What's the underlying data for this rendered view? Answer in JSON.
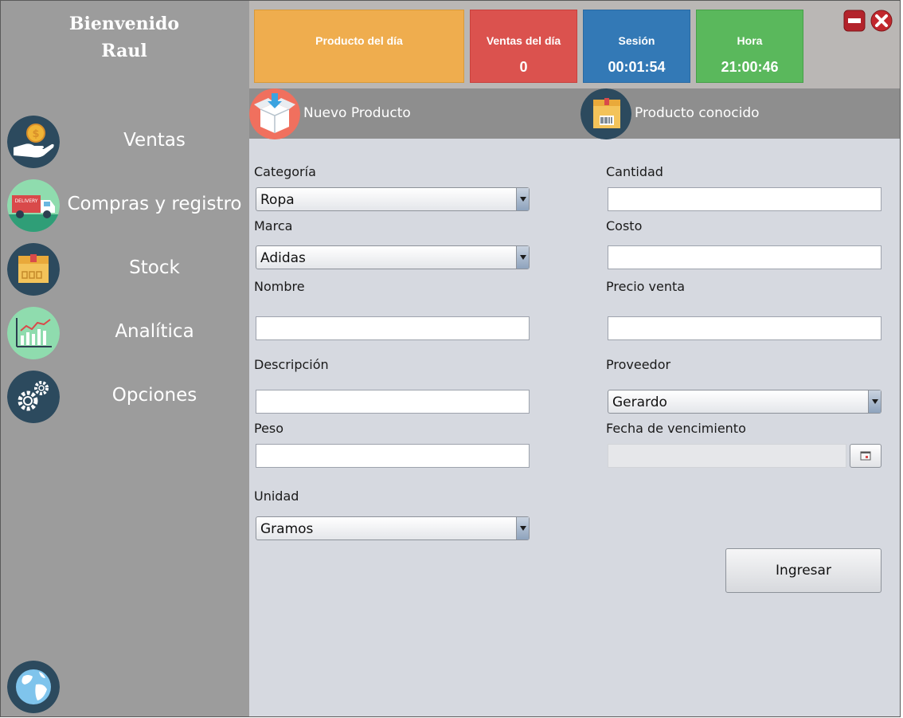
{
  "sidebar": {
    "welcome": "Bienvenido",
    "user": "Raul",
    "items": [
      {
        "label": "Ventas",
        "icon": "money-hand-icon"
      },
      {
        "label": "Compras y registro",
        "icon": "delivery-truck-icon"
      },
      {
        "label": "Stock",
        "icon": "box-icon"
      },
      {
        "label": "Analítica",
        "icon": "chart-icon"
      },
      {
        "label": "Opciones",
        "icon": "gears-icon"
      }
    ],
    "bottom_icon": "globe-icon"
  },
  "status": {
    "product_of_day": {
      "title": "Producto del día",
      "value": "",
      "color": "#efad4e"
    },
    "sales_of_day": {
      "title": "Ventas del día",
      "value": "0",
      "color": "#db524e"
    },
    "session": {
      "title": "Sesión",
      "value": "00:01:54",
      "color": "#3379b6"
    },
    "time": {
      "title": "Hora",
      "value": "21:00:46",
      "color": "#5ab85c"
    }
  },
  "tabs": [
    {
      "label": "Nuevo Producto",
      "icon": "open-box-icon"
    },
    {
      "label": "Producto conocido",
      "icon": "barcode-box-icon"
    }
  ],
  "form": {
    "categoria": {
      "label": "Categoría",
      "value": "Ropa"
    },
    "marca": {
      "label": "Marca",
      "value": "Adidas"
    },
    "nombre": {
      "label": "Nombre",
      "value": ""
    },
    "descripcion": {
      "label": "Descripción",
      "value": ""
    },
    "peso": {
      "label": "Peso",
      "value": ""
    },
    "unidad": {
      "label": "Unidad",
      "value": "Gramos"
    },
    "cantidad": {
      "label": "Cantidad",
      "value": ""
    },
    "costo": {
      "label": "Costo",
      "value": ""
    },
    "precio_venta": {
      "label": "Precio venta",
      "value": ""
    },
    "proveedor": {
      "label": "Proveedor",
      "value": "Gerardo"
    },
    "fecha_vencimiento": {
      "label": "Fecha de vencimiento",
      "value": ""
    },
    "submit": "Ingresar"
  },
  "colors": {
    "sidebar": "#9c9c9c",
    "content": "#d6d9e0",
    "icon_navy": "#2c4a5e"
  }
}
